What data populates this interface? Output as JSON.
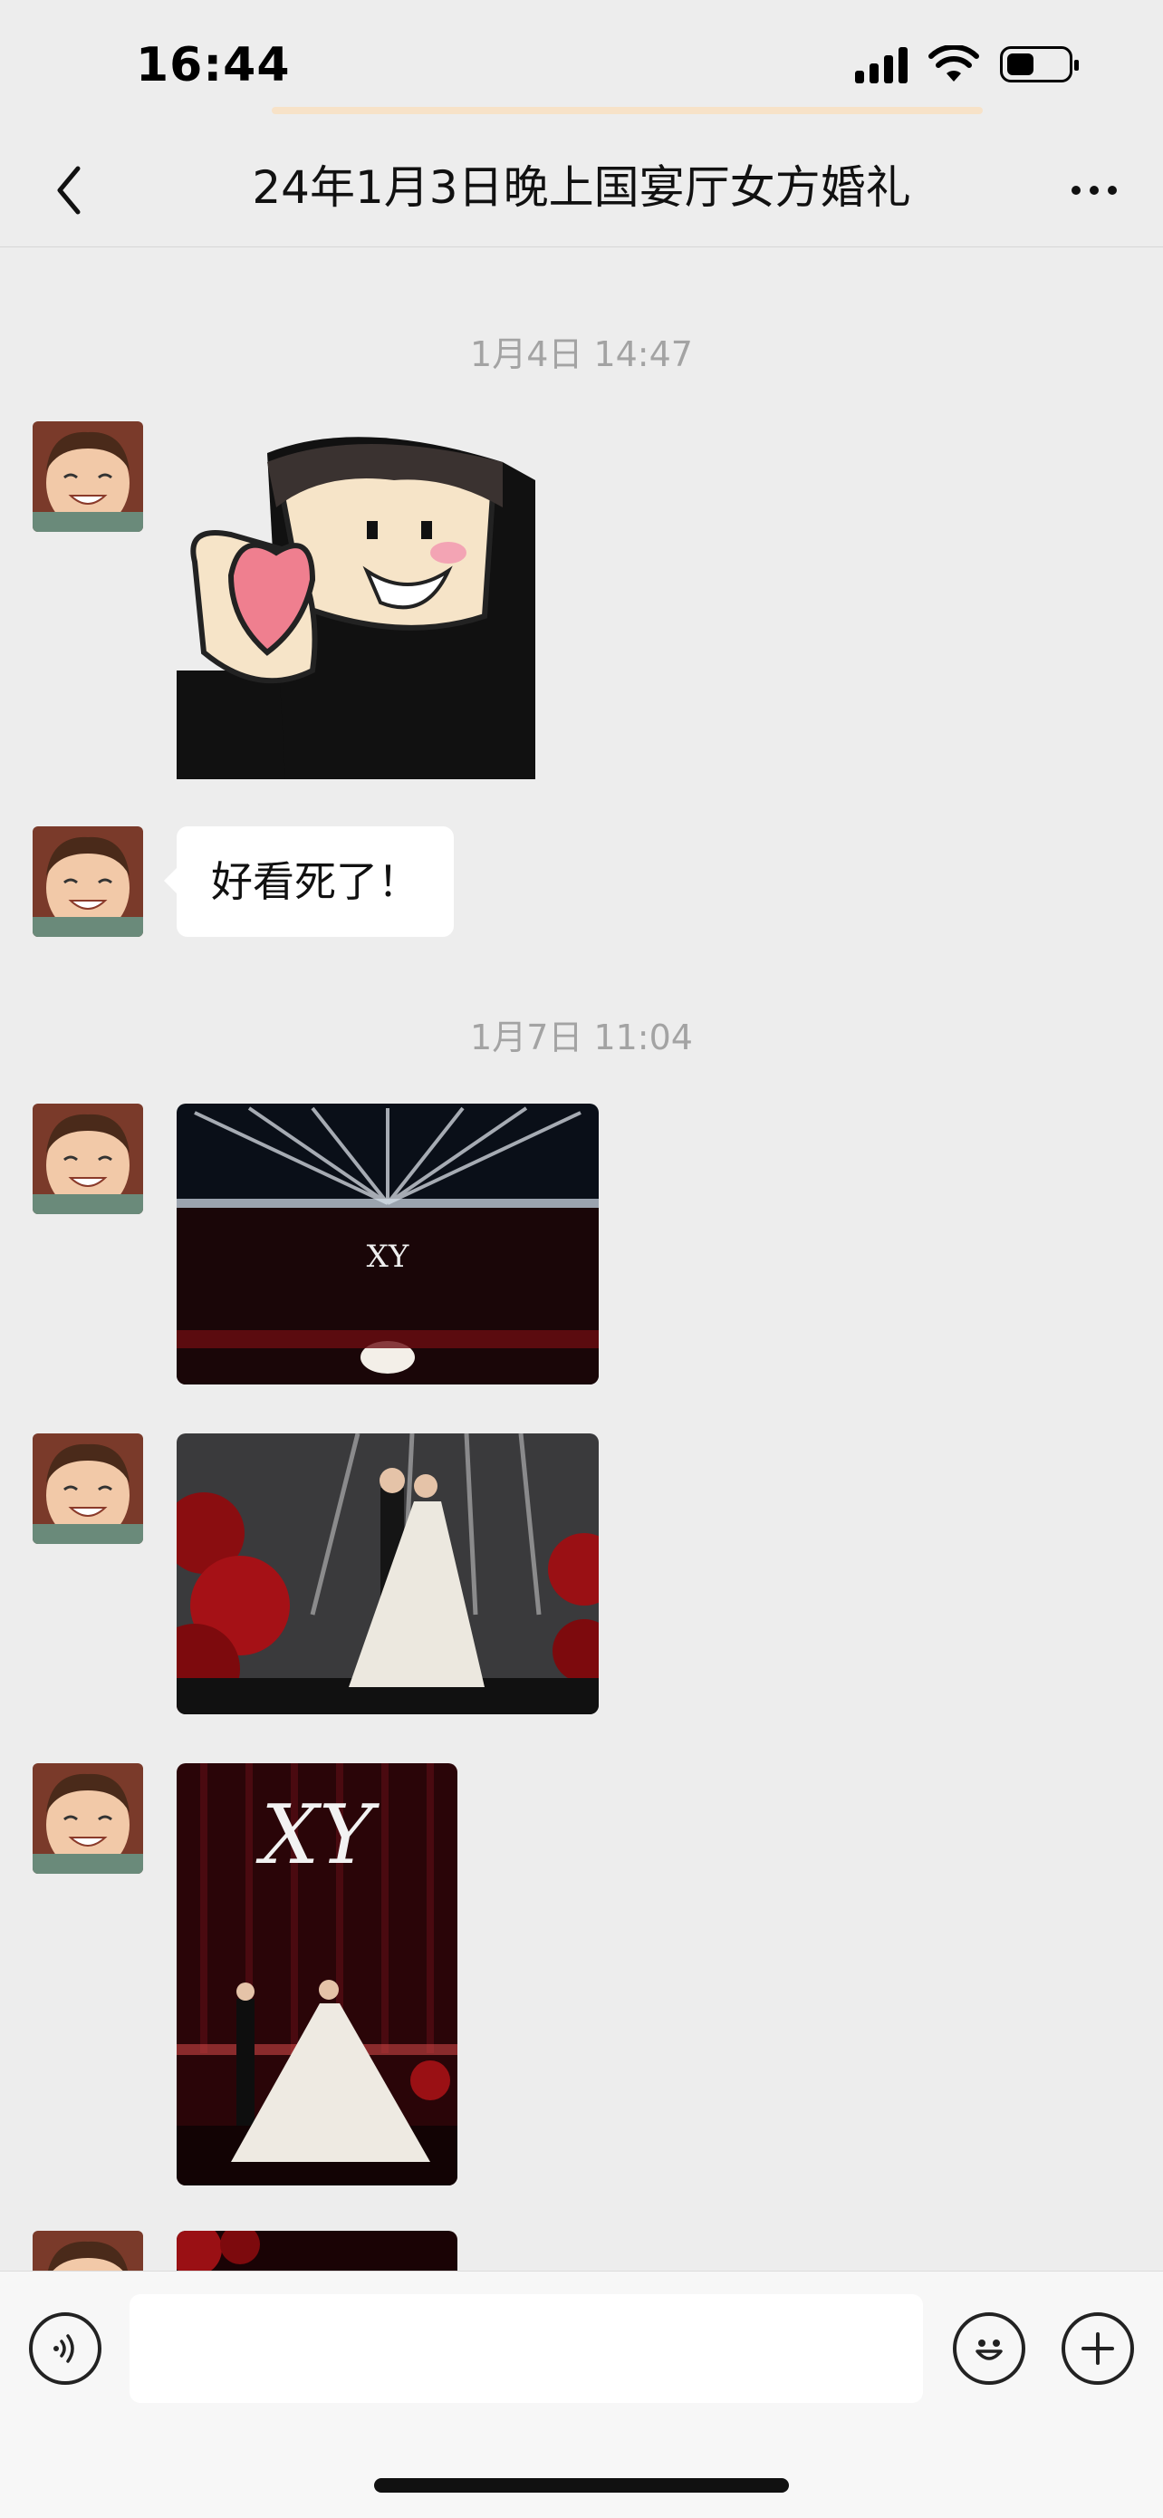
{
  "status_bar": {
    "time": "16:44",
    "battery_level": 0.45
  },
  "header": {
    "title": "24年1月3日晚上国宴厅女方婚礼"
  },
  "chat": {
    "messages": [
      {
        "timestamp": "1月4日 14:47"
      },
      {
        "type": "sticker",
        "description_icon": "heart-sticker"
      },
      {
        "type": "text",
        "text": "好看死了！"
      },
      {
        "timestamp": "1月7日 11:04"
      },
      {
        "type": "image",
        "subject": "wedding-stage-lights"
      },
      {
        "type": "image",
        "subject": "wedding-couple-red-flowers"
      },
      {
        "type": "image",
        "subject": "wedding-couple-monogram"
      },
      {
        "type": "image",
        "subject": "wedding-partial"
      }
    ]
  },
  "input_bar": {
    "value": "",
    "placeholder": ""
  },
  "colors": {
    "background": "#ededed",
    "bubble": "#ffffff",
    "timestamp": "#a3a3a3",
    "title_underline": "#f7e2c8"
  }
}
